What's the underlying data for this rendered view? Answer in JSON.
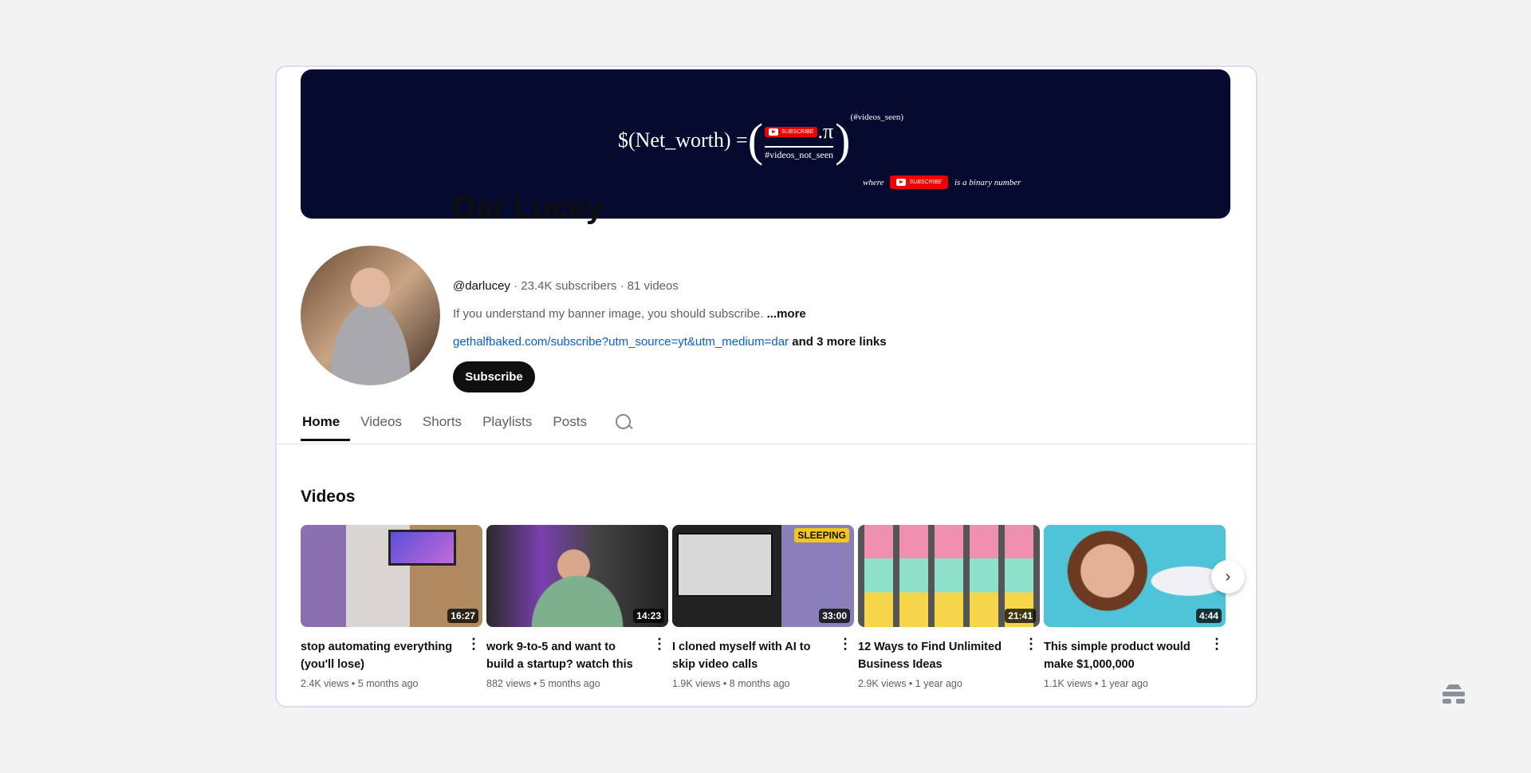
{
  "banner": {
    "lhs": "$(Net_worth) =",
    "dot_pi": ".π",
    "exponent": "(#videos_seen)",
    "denominator": "#videos_not_seen",
    "subscribe_badge": "SUBSCRIBE",
    "where": "where",
    "binary": "is a binary number"
  },
  "channel": {
    "name": "Dar Lucey",
    "handle": "@darlucey",
    "stats": " · 23.4K subscribers · 81 videos",
    "description": "If you understand my banner image, you should subscribe. ",
    "more": "...more",
    "link": "gethalfbaked.com/subscribe?utm_source=yt&utm_medium=dar",
    "more_links": " and 3 more links",
    "subscribe": "Subscribe"
  },
  "tabs": [
    "Home",
    "Videos",
    "Shorts",
    "Playlists",
    "Posts"
  ],
  "section_title": "Videos",
  "videos": [
    {
      "title": "stop automating everything (you'll lose)",
      "duration": "16:27",
      "meta": "2.4K views • 5 months ago"
    },
    {
      "title": "work 9-to-5 and want to build a startup? watch this",
      "duration": "14:23",
      "meta": "882 views • 5 months ago"
    },
    {
      "title": "I cloned myself with AI to skip video calls",
      "duration": "33:00",
      "meta": "1.9K views • 8 months ago",
      "badge": "SLEEPING"
    },
    {
      "title": "12 Ways to Find Unlimited Business Ideas",
      "duration": "21:41",
      "meta": "2.9K views • 1 year ago"
    },
    {
      "title": "This simple product would make $1,000,000",
      "duration": "4:44",
      "meta": "1.1K views • 1 year ago"
    }
  ]
}
